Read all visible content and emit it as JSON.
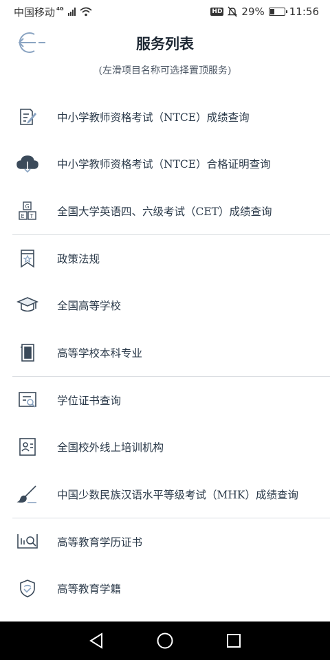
{
  "status": {
    "carrier": "中国移动",
    "network": "4G",
    "battery": "29%",
    "battery_level": 0.29,
    "time": "11:56",
    "hd": "HD"
  },
  "header": {
    "title": "服务列表",
    "subtitle": "(左滑项目名称可选择置顶服务)"
  },
  "services": [
    {
      "label": "中小学教师资格考试（NTCE）成绩查询",
      "icon": "form-edit-icon"
    },
    {
      "label": "中小学教师资格考试（NTCE）合格证明查询",
      "icon": "cloud-download-icon"
    },
    {
      "label": "全国大学英语四、六级考试（CET）成绩查询",
      "icon": "letter-blocks-icon"
    },
    {
      "label": "政策法规",
      "icon": "bookmark-star-icon"
    },
    {
      "label": "全国高等学校",
      "icon": "graduation-cap-icon"
    },
    {
      "label": "高等学校本科专业",
      "icon": "book-icon"
    },
    {
      "label": "学位证书查询",
      "icon": "certificate-search-icon"
    },
    {
      "label": "全国校外线上培训机构",
      "icon": "id-card-icon"
    },
    {
      "label": "中国少数民族汉语水平等级考试（MHK）成绩查询",
      "icon": "brush-icon"
    },
    {
      "label": "高等教育学历证书",
      "icon": "chart-search-icon"
    },
    {
      "label": "高等教育学籍",
      "icon": "shield-icon"
    }
  ],
  "colors": {
    "icon": "#3b4a5a",
    "accent": "#8aa4c2",
    "divider": "#d9dde1"
  }
}
